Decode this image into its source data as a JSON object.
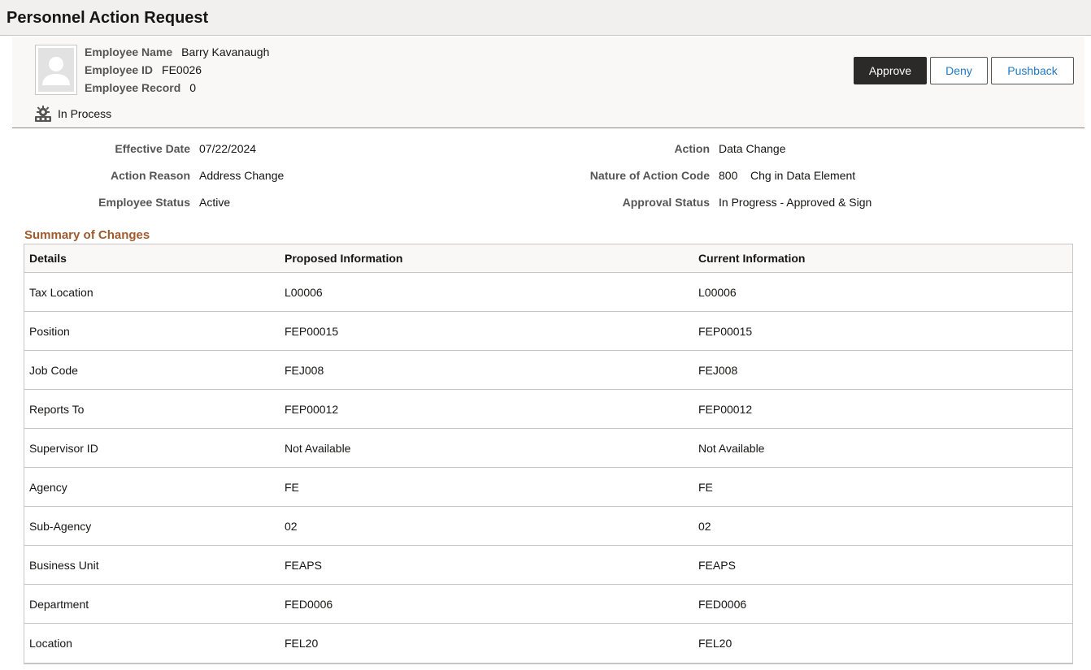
{
  "page": {
    "title": "Personnel Action Request"
  },
  "employee": {
    "name_label": "Employee Name",
    "name": "Barry Kavanaugh",
    "id_label": "Employee ID",
    "id": "FE0026",
    "record_label": "Employee Record",
    "record": "0",
    "photo_icon": "person-silhouette-icon",
    "status_icon": "gear-process-icon",
    "status": "In Process"
  },
  "actions": {
    "approve_label": "Approve",
    "deny_label": "Deny",
    "pushback_label": "Pushback",
    "approve_color": "#2b2a28",
    "link_color": "#227ac0"
  },
  "details": {
    "effective_date_label": "Effective Date",
    "effective_date": "07/22/2024",
    "action_reason_label": "Action Reason",
    "action_reason": "Address Change",
    "employee_status_label": "Employee Status",
    "employee_status": "Active",
    "action_label": "Action",
    "action": "Data Change",
    "noa_code_label": "Nature of Action Code",
    "noa_code": "800",
    "noa_desc": "Chg in Data Element",
    "approval_status_label": "Approval Status",
    "approval_status": "In Progress - Approved & Sign"
  },
  "summary": {
    "title": "Summary of Changes",
    "title_color": "#a05a2c",
    "columns": [
      "Details",
      "Proposed Information",
      "Current Information"
    ],
    "rows": [
      [
        "Tax Location",
        "L00006",
        "L00006"
      ],
      [
        "Position",
        "FEP00015",
        "FEP00015"
      ],
      [
        "Job Code",
        "FEJ008",
        "FEJ008"
      ],
      [
        "Reports To",
        "FEP00012",
        "FEP00012"
      ],
      [
        "Supervisor ID",
        "Not Available",
        "Not Available"
      ],
      [
        "Agency",
        "FE",
        "FE"
      ],
      [
        "Sub-Agency",
        "02",
        "02"
      ],
      [
        "Business Unit",
        "FEAPS",
        "FEAPS"
      ],
      [
        "Department",
        "FED0006",
        "FED0006"
      ],
      [
        "Location",
        "FEL20",
        "FEL20"
      ]
    ]
  }
}
